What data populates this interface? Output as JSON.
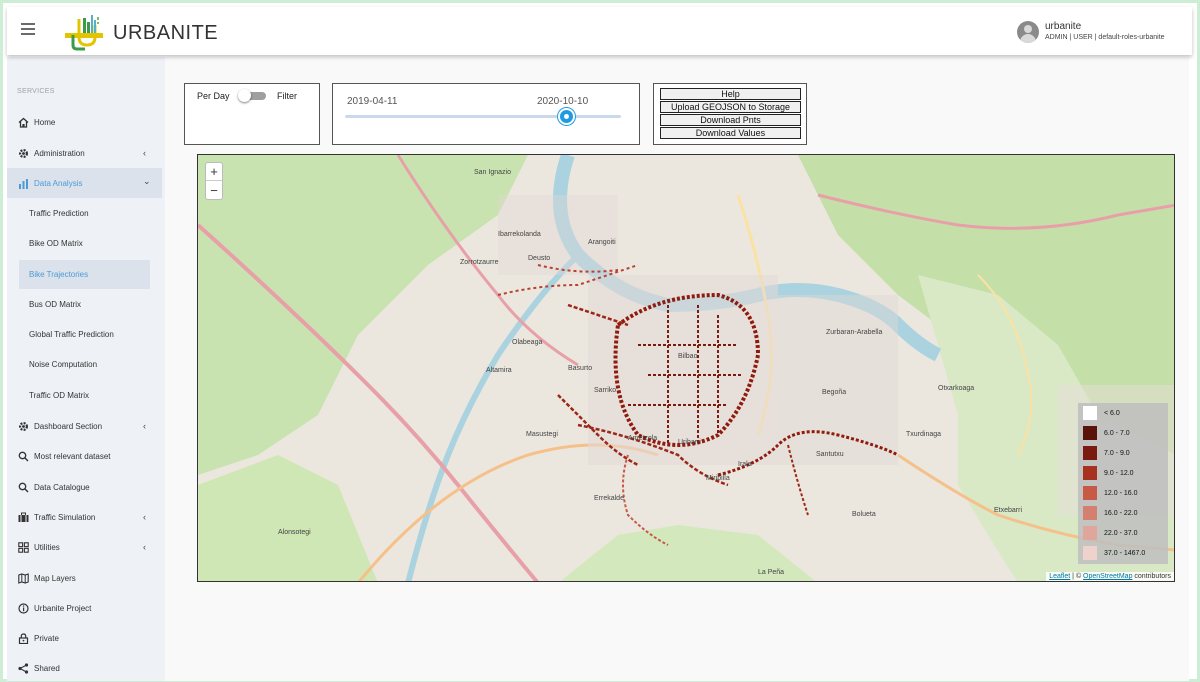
{
  "header": {
    "brand": "URBANITE",
    "user_name": "urbanite",
    "user_roles": "ADMIN | USER | default-roles-urbanite"
  },
  "sidebar": {
    "heading": "SERVICES",
    "items": [
      {
        "label": "Home",
        "icon": "home-icon"
      },
      {
        "label": "Administration",
        "icon": "gear-icon",
        "chevron": "‹"
      },
      {
        "label": "Data Analysis",
        "icon": "bar-chart-icon",
        "chevron": "⌄"
      },
      {
        "label": "Dashboard Section",
        "icon": "gear-icon",
        "chevron": "‹"
      },
      {
        "label": "Most relevant dataset",
        "icon": "search-icon"
      },
      {
        "label": "Data Catalogue",
        "icon": "search-icon"
      },
      {
        "label": "Traffic Simulation",
        "icon": "briefcase-icon",
        "chevron": "‹"
      },
      {
        "label": "Utilities",
        "icon": "grid-icon",
        "chevron": "‹"
      },
      {
        "label": "Map Layers",
        "icon": "map-icon"
      },
      {
        "label": "Urbanite Project",
        "icon": "info-icon"
      },
      {
        "label": "Private",
        "icon": "lock-icon"
      },
      {
        "label": "Shared",
        "icon": "share-icon"
      }
    ],
    "sub_items": [
      "Traffic Prediction",
      "Bike OD Matrix",
      "Bike Trajectories",
      "Bus OD Matrix",
      "Global Traffic Prediction",
      "Noise Computation",
      "Traffic OD Matrix"
    ]
  },
  "controls": {
    "per_day_label": "Per Day",
    "filter_label": "Filter",
    "toggle_on": false,
    "date_start": "2019-04-11",
    "date_end": "2020-10-10",
    "slider_fraction": 0.8,
    "buttons": [
      "Help",
      "Upload GEOJSON to Storage",
      "Download Pnts",
      "Download Values"
    ]
  },
  "map": {
    "zoom_in": "+",
    "zoom_out": "−",
    "legend": [
      {
        "label": "< 6.0",
        "color": "#ffffff"
      },
      {
        "label": "6.0 - 7.0",
        "color": "#5a1309"
      },
      {
        "label": "7.0 - 9.0",
        "color": "#7b1a0e"
      },
      {
        "label": "9.0 - 12.0",
        "color": "#a83220"
      },
      {
        "label": "12.0 - 16.0",
        "color": "#c65a47"
      },
      {
        "label": "16.0 - 22.0",
        "color": "#d47f70"
      },
      {
        "label": "22.0 - 37.0",
        "color": "#e0a59b"
      },
      {
        "label": "37.0 - 1467.0",
        "color": "#f0d2cc"
      }
    ],
    "attribution_leaflet": "Leaflet",
    "attribution_sep": " | © ",
    "attribution_osm": "OpenStreetMap",
    "attribution_tail": " contributors",
    "place_labels": [
      "Zorrotzaurre",
      "San Ignazio",
      "Deusto",
      "Ibarrekolanda",
      "Arangoiti",
      "Basurto",
      "Bilbao",
      "Zurbaran-Arabella",
      "Begoña",
      "Otxarkoaga",
      "Txurdinaga",
      "Ametzola",
      "Masustegi",
      "Errekalde",
      "Miribilla",
      "Bolueta",
      "Etxebarri",
      "Altamira",
      "Olabeaga",
      "Uribarri",
      "Sarriko",
      "Irala",
      "Santutxu",
      "Alonsotegi",
      "La Peña"
    ]
  }
}
